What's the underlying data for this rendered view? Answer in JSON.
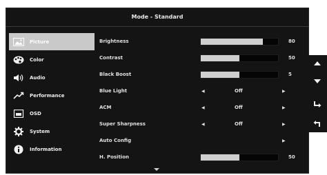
{
  "title": "Mode - Standard",
  "sidebar": {
    "items": [
      {
        "label": "Picture",
        "icon": "picture-icon",
        "active": true
      },
      {
        "label": "Color",
        "icon": "palette-icon"
      },
      {
        "label": "Audio",
        "icon": "speaker-icon"
      },
      {
        "label": "Performance",
        "icon": "performance-icon"
      },
      {
        "label": "OSD",
        "icon": "osd-icon"
      },
      {
        "label": "System",
        "icon": "gear-icon"
      },
      {
        "label": "Information",
        "icon": "info-icon"
      }
    ]
  },
  "settings": {
    "brightness": {
      "label": "Brightness",
      "value": "80",
      "level": 80
    },
    "contrast": {
      "label": "Contrast",
      "value": "50",
      "level": 50
    },
    "black_boost": {
      "label": "Black Boost",
      "value": "5",
      "level": 50
    },
    "blue_light": {
      "label": "Blue Light",
      "value": "Off"
    },
    "acm": {
      "label": "ACM",
      "value": "Off"
    },
    "super_sharpness": {
      "label": "Super Sharpness",
      "value": "Off"
    },
    "auto_config": {
      "label": "Auto Config"
    },
    "h_position": {
      "label": "H. Position",
      "value": "50",
      "level": 50
    }
  },
  "keypad": {
    "keys": [
      "up-arrow-icon",
      "down-arrow-icon",
      "enter-icon",
      "back-icon"
    ]
  },
  "colors": {
    "background": "#141414",
    "highlight": "#c9c9c9",
    "bar_fill": "#cfcfcf"
  }
}
